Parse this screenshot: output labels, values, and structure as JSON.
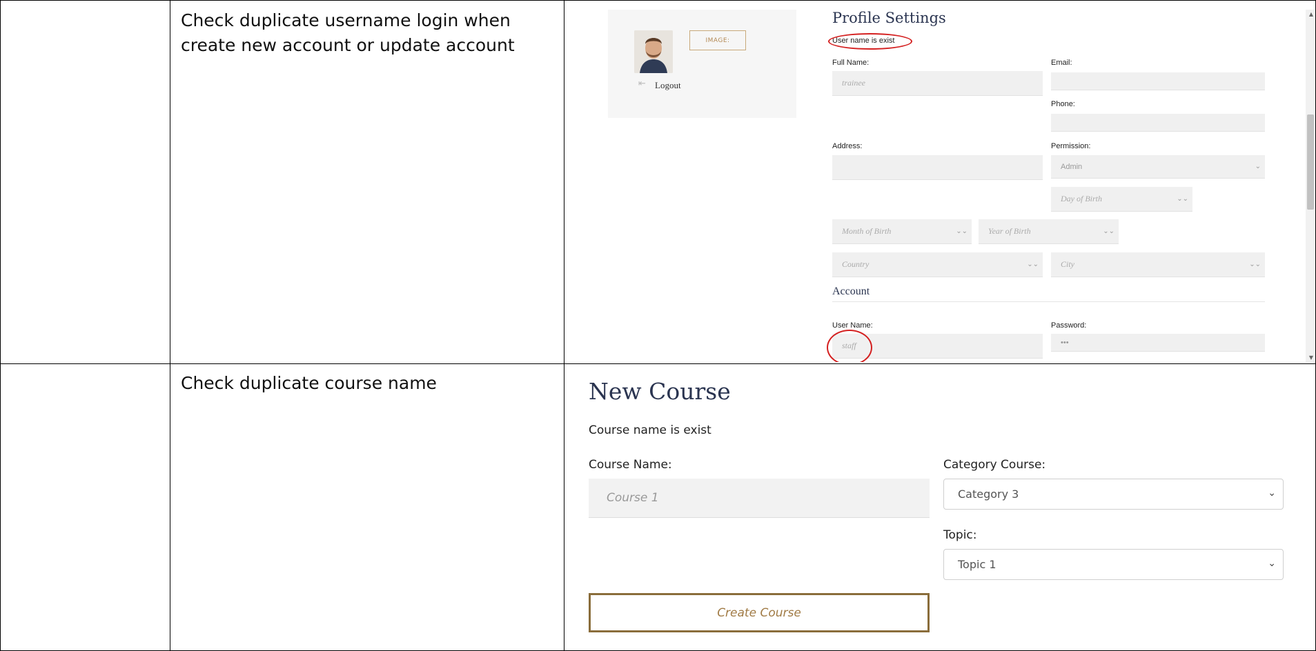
{
  "rows": [
    {
      "description": "Check duplicate username login when\ncreate new account or update account",
      "screenshot": {
        "profile_title": "Profile Settings",
        "error_text": "User name is exist",
        "image_button": "IMAGE:",
        "logout_label": "Logout",
        "fields": {
          "full_name_label": "Full Name:",
          "full_name_value": "trainee",
          "email_label": "Email:",
          "phone_label": "Phone:",
          "address_label": "Address:",
          "permission_label": "Permission:",
          "permission_value": "Admin",
          "day_placeholder": "Day of Birth",
          "month_placeholder": "Month of Birth",
          "year_placeholder": "Year of Birth",
          "country_placeholder": "Country",
          "city_placeholder": "City"
        },
        "account_title": "Account",
        "username_label": "User Name:",
        "username_value": "staff",
        "password_label": "Password:",
        "password_value": "•••"
      }
    },
    {
      "description": "Check duplicate course name",
      "screenshot": {
        "title": "New Course",
        "error_text": "Course name is exist",
        "course_name_label": "Course Name:",
        "course_name_value": "Course 1",
        "category_label": "Category Course:",
        "category_value": "Category 3",
        "topic_label": "Topic:",
        "topic_value": "Topic 1",
        "create_button": "Create Course"
      }
    }
  ],
  "icons": {
    "logout": "logout-icon",
    "select_arrow": "chevron-down-icon"
  },
  "colors": {
    "annotation": "#d42020",
    "heading": "#2a3450",
    "button_border": "#8a6d3b"
  }
}
